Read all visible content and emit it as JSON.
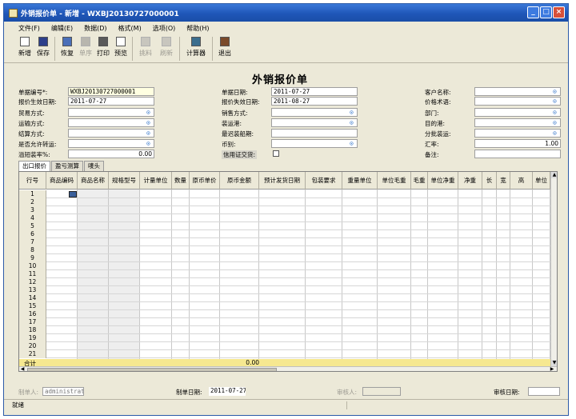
{
  "window": {
    "title": "外销报价单 - 新增 - WXBJ20130727000001"
  },
  "menu": [
    "文件(F)",
    "编辑(E)",
    "数据(D)",
    "格式(M)",
    "选项(O)",
    "帮助(H)"
  ],
  "toolbar": [
    {
      "label": "新增",
      "icon": "new-document-icon",
      "enabled": true
    },
    {
      "label": "保存",
      "icon": "save-disk-icon",
      "enabled": true
    },
    {
      "label": "恢复",
      "icon": "undo-icon",
      "enabled": true
    },
    {
      "label": "单序",
      "icon": "reorder-icon",
      "enabled": false
    },
    {
      "label": "打印",
      "icon": "printer-icon",
      "enabled": true
    },
    {
      "label": "预览",
      "icon": "preview-icon",
      "enabled": true
    },
    {
      "label": "挑料",
      "icon": "pick-material-icon",
      "enabled": false
    },
    {
      "label": "刷新",
      "icon": "refresh-icon",
      "enabled": false
    },
    {
      "label": "计算器",
      "icon": "calculator-icon",
      "enabled": true
    },
    {
      "label": "退出",
      "icon": "exit-icon",
      "enabled": true
    }
  ],
  "form": {
    "title": "外销报价单",
    "col1": [
      {
        "label": "单据编号*:",
        "value": "WXBJ20130727000001",
        "highlight": true
      },
      {
        "label": "报价生效日期:",
        "value": "2011-07-27"
      },
      {
        "label": "贸易方式:",
        "value": "",
        "lookup": true
      },
      {
        "label": "运输方式:",
        "value": "",
        "lookup": true
      },
      {
        "label": "结算方式:",
        "value": "",
        "lookup": true
      },
      {
        "label": "是否允许转运:",
        "value": "",
        "lookup": true
      },
      {
        "label": "溢短装率%:",
        "value": "0.00",
        "numeric": true
      }
    ],
    "col2": [
      {
        "label": "单据日期:",
        "value": "2011-07-27"
      },
      {
        "label": "报价失效日期:",
        "value": "2011-08-27"
      },
      {
        "label": "销售方式:",
        "value": "",
        "lookup": true
      },
      {
        "label": "装运港:",
        "value": "",
        "lookup": true
      },
      {
        "label": "最迟装船期:",
        "value": ""
      },
      {
        "label": "币别:",
        "value": "",
        "lookup": true
      }
    ],
    "credit_label": "信用证交货:",
    "col3": [
      {
        "label": "客户名称:",
        "value": "",
        "lookup": true
      },
      {
        "label": "价格术语:",
        "value": "",
        "lookup": true
      },
      {
        "label": "部门:",
        "value": "",
        "lookup": true
      },
      {
        "label": "目的港:",
        "value": "",
        "lookup": true
      },
      {
        "label": "分批装运:",
        "value": "",
        "lookup": true
      },
      {
        "label": "汇率:",
        "value": "1.00",
        "numeric": true
      },
      {
        "label": "备注:",
        "value": ""
      }
    ]
  },
  "tabs": [
    "出口报价",
    "盈亏测算",
    "唛头"
  ],
  "grid": {
    "columns": [
      "行号",
      "商品编码",
      "商品名称",
      "规格型号",
      "计量单位",
      "数量",
      "原币单价",
      "原币金额",
      "预计发货日期",
      "包装要求",
      "重量单位",
      "单位毛重",
      "毛重",
      "单位净重",
      "净重",
      "长",
      "宽",
      "高",
      "单位"
    ],
    "rows": [
      "1",
      "2",
      "3",
      "4",
      "5",
      "6",
      "7",
      "8",
      "9",
      "10",
      "11",
      "12",
      "13",
      "14",
      "15",
      "16",
      "17",
      "18",
      "19",
      "20",
      "21"
    ],
    "total_label": "合计",
    "total_amount": "0.00"
  },
  "footer": {
    "creator_label": "制单人:",
    "creator_value": "administrato",
    "create_date_label": "制单日期:",
    "create_date_value": "2011-07-27",
    "auditor_label": "审核人:",
    "auditor_value": "",
    "audit_date_label": "审核日期:",
    "audit_date_value": ""
  },
  "status": {
    "text": "就绪"
  }
}
